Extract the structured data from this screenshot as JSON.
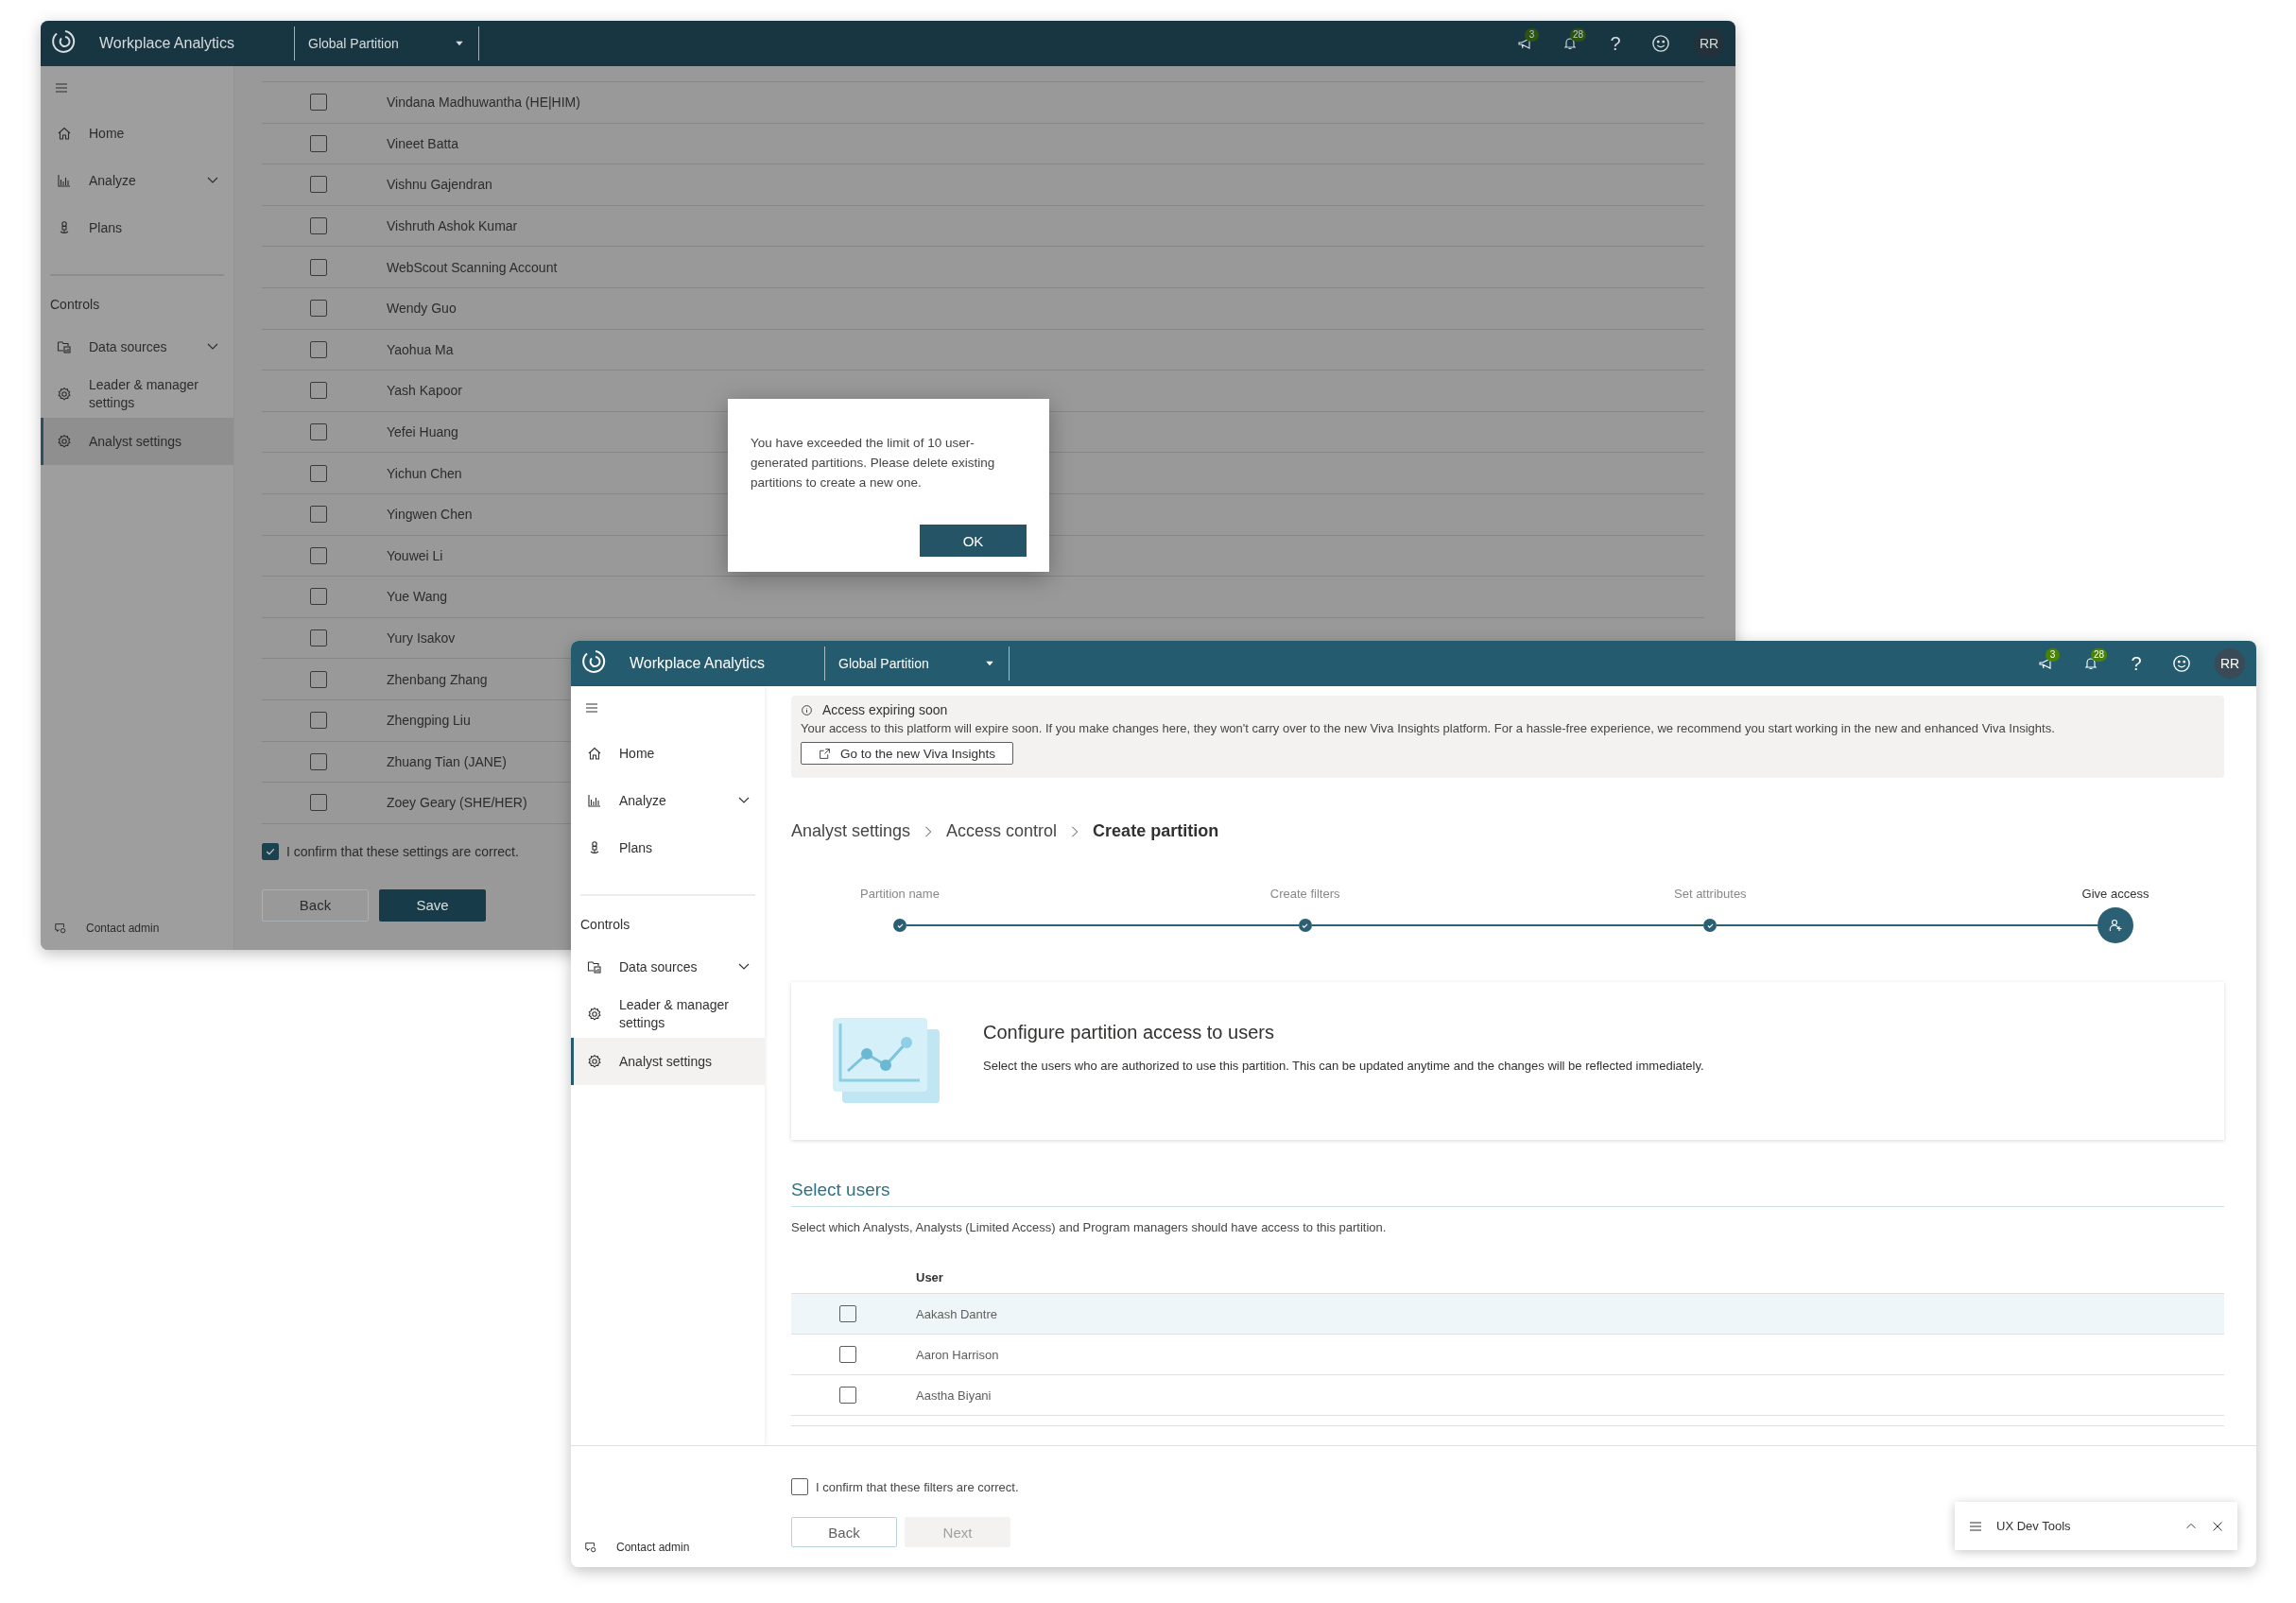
{
  "background_window": {
    "app_title": "Workplace Analytics",
    "partition": "Global Partition",
    "top_bar": {
      "announcements": "3",
      "notifications": "28",
      "help": "?",
      "avatar": "RR"
    },
    "sidebar": {
      "nav": [
        {
          "kind": "home",
          "label": "Home",
          "expandable": false,
          "selected": false
        },
        {
          "kind": "analyze",
          "label": "Analyze",
          "expandable": true,
          "selected": false
        },
        {
          "kind": "plans",
          "label": "Plans",
          "expandable": false,
          "selected": false
        }
      ],
      "section": "Controls",
      "controls": [
        {
          "kind": "data_sources",
          "label": "Data sources",
          "expandable": true,
          "selected": false
        },
        {
          "kind": "settings",
          "label": "Leader & manager settings",
          "expandable": false,
          "selected": false
        },
        {
          "kind": "settings",
          "label": "Analyst settings",
          "expandable": false,
          "selected": true
        }
      ],
      "contact": "Contact admin"
    },
    "users": [
      {
        "name": "Vindana Madhuwantha (HE|HIM)",
        "checked": false
      },
      {
        "name": "Vineet Batta",
        "checked": false
      },
      {
        "name": "Vishnu Gajendran",
        "checked": false
      },
      {
        "name": "Vishruth Ashok Kumar",
        "checked": false
      },
      {
        "name": "WebScout Scanning Account",
        "checked": false
      },
      {
        "name": "Wendy Guo",
        "checked": false
      },
      {
        "name": "Yaohua Ma",
        "checked": false
      },
      {
        "name": "Yash Kapoor",
        "checked": false
      },
      {
        "name": "Yefei Huang",
        "checked": false
      },
      {
        "name": "Yichun Chen",
        "checked": false
      },
      {
        "name": "Yingwen Chen",
        "checked": false
      },
      {
        "name": "Youwei Li",
        "checked": false
      },
      {
        "name": "Yue Wang",
        "checked": false
      },
      {
        "name": "Yury Isakov",
        "checked": false
      },
      {
        "name": "Zhenbang Zhang",
        "checked": false
      },
      {
        "name": "Zhengping Liu",
        "checked": false
      },
      {
        "name": "Zhuang Tian (JANE)",
        "checked": false
      },
      {
        "name": "Zoey Geary (SHE/HER)",
        "checked": false
      }
    ],
    "confirm": {
      "label": "I confirm that these settings are correct.",
      "checked": true
    },
    "buttons": [
      {
        "label": "Back",
        "kind": "secondary",
        "disabled": false
      },
      {
        "label": "Save",
        "kind": "primary",
        "disabled": false
      }
    ],
    "dialog": {
      "message": "You have exceeded the limit of 10 user-generated partitions. Please delete existing partitions to create a new one.",
      "button": "OK"
    }
  },
  "foreground_window": {
    "app_title": "Workplace Analytics",
    "partition": "Global Partition",
    "top_bar": {
      "announcements": "3",
      "notifications": "28",
      "help": "?",
      "avatar": "RR"
    },
    "sidebar": {
      "nav": [
        {
          "kind": "home",
          "label": "Home",
          "expandable": false,
          "selected": false
        },
        {
          "kind": "analyze",
          "label": "Analyze",
          "expandable": true,
          "selected": false
        },
        {
          "kind": "plans",
          "label": "Plans",
          "expandable": false,
          "selected": false
        }
      ],
      "section": "Controls",
      "controls": [
        {
          "kind": "data_sources",
          "label": "Data sources",
          "expandable": true,
          "selected": false
        },
        {
          "kind": "settings",
          "label": "Leader & manager settings",
          "expandable": false,
          "selected": false
        },
        {
          "kind": "settings",
          "label": "Analyst settings",
          "expandable": false,
          "selected": true
        }
      ],
      "contact": "Contact admin"
    },
    "alert": {
      "title": "Access expiring soon",
      "message": "Your access to this platform will expire soon. If you make changes here, they won't carry over to the new Viva Insights platform. For a hassle-free experience, we recommend you start working in the new and enhanced Viva Insights.",
      "button": "Go to the new Viva Insights"
    },
    "breadcrumb": [
      {
        "label": "Analyst settings",
        "current": false
      },
      {
        "label": "Access control",
        "current": false
      },
      {
        "label": "Create partition",
        "current": true
      }
    ],
    "steps": [
      {
        "label": "Partition name",
        "current": false
      },
      {
        "label": "Create filters",
        "current": false
      },
      {
        "label": "Set attributes",
        "current": false
      },
      {
        "label": "Give access",
        "current": true
      }
    ],
    "card": {
      "title": "Configure partition access to users",
      "description": "Select the users who are authorized to use this partition. This can be updated anytime and the changes will be reflected immediately."
    },
    "select_users": {
      "heading": "Select users",
      "description": "Select which Analysts, Analysts (Limited Access) and Program managers should have access to this partition.",
      "column": "User",
      "rows": [
        {
          "name": "Aakash Dantre",
          "checked": false,
          "hovered": true
        },
        {
          "name": "Aaron Harrison",
          "checked": false,
          "hovered": false
        },
        {
          "name": "Aastha Biyani",
          "checked": false,
          "hovered": false
        }
      ]
    },
    "confirm": {
      "label": "I confirm that these filters are correct.",
      "checked": false
    },
    "buttons": [
      {
        "label": "Back",
        "kind": "secondary",
        "disabled": false
      },
      {
        "label": "Next",
        "kind": "primary",
        "disabled": true
      }
    ]
  },
  "dev_tools": {
    "title": "UX Dev Tools"
  }
}
